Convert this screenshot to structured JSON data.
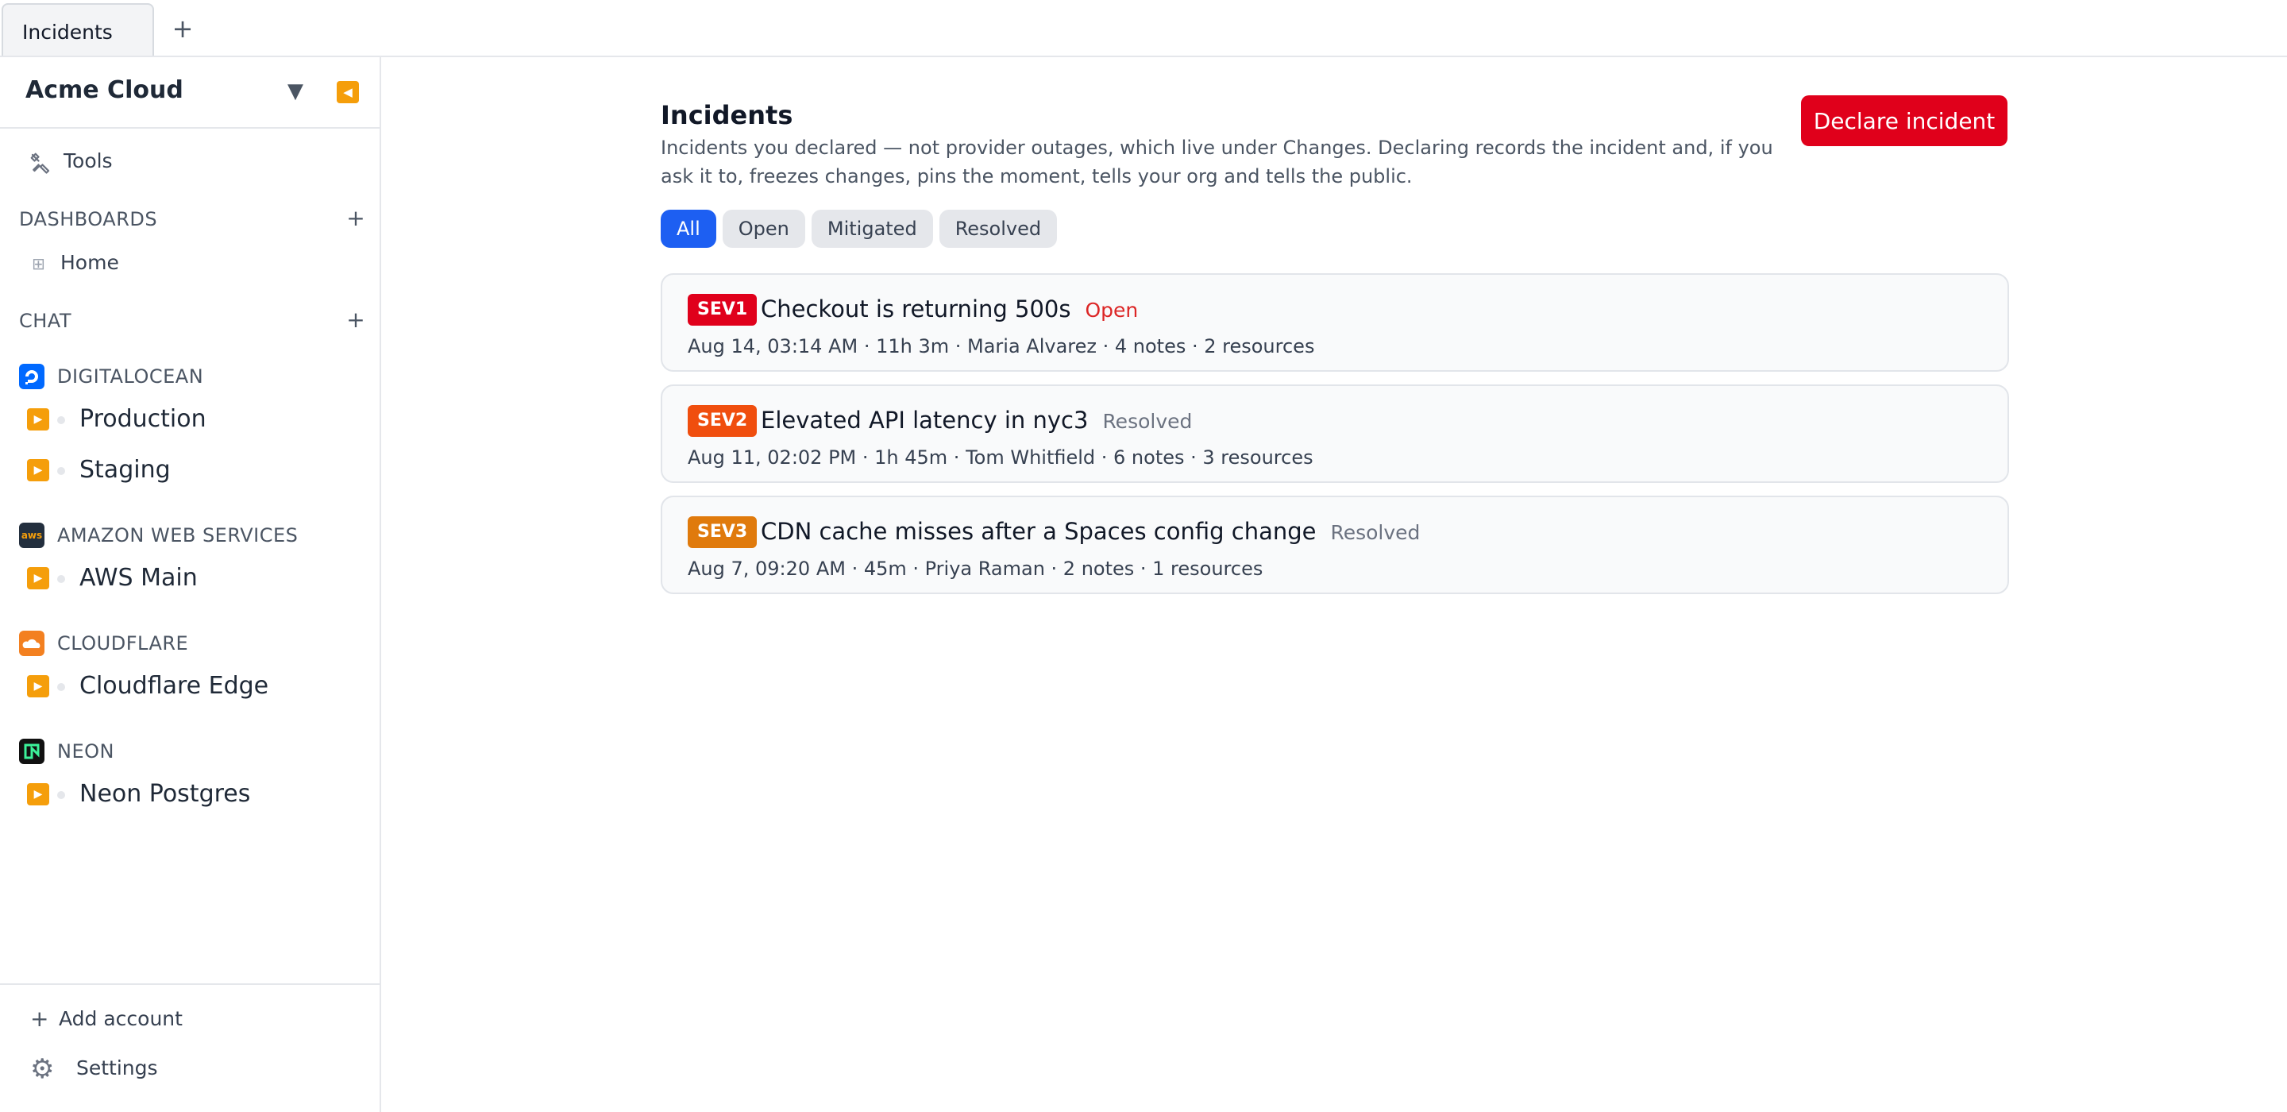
{
  "tabs": [
    {
      "label": "Incidents"
    }
  ],
  "tab_add": "+",
  "sidebar": {
    "org_name": "Acme Cloud",
    "tools_label": "Tools",
    "dashboards_label": "DASHBOARDS",
    "dashboards_add": "+",
    "home_label": "Home",
    "chat_label": "CHAT",
    "chat_add": "+",
    "providers": [
      {
        "name": "DIGITALOCEAN",
        "icon": "digitalocean-icon",
        "color": "#0069ff",
        "accounts": [
          {
            "label": "Production"
          },
          {
            "label": "Staging"
          }
        ]
      },
      {
        "name": "AMAZON WEB SERVICES",
        "icon": "aws-icon",
        "color": "#232f3e",
        "logo_text": "aws",
        "accounts": [
          {
            "label": "AWS Main"
          }
        ]
      },
      {
        "name": "CLOUDFLARE",
        "icon": "cloudflare-icon",
        "color": "#f38020",
        "accounts": [
          {
            "label": "Cloudflare Edge"
          }
        ]
      },
      {
        "name": "NEON",
        "icon": "neon-icon",
        "color": "#111111",
        "accounts": [
          {
            "label": "Neon Postgres"
          }
        ]
      }
    ],
    "add_account_label": "Add account",
    "settings_label": "Settings"
  },
  "main": {
    "title": "Incidents",
    "description": "Incidents you declared — not provider outages, which live under Changes. Declaring records the incident and, if you ask it to, freezes changes, pins the moment, tells your org and tells the public.",
    "declare_button": "Declare incident",
    "filters": [
      {
        "label": "All",
        "active": true
      },
      {
        "label": "Open",
        "active": false
      },
      {
        "label": "Mitigated",
        "active": false
      },
      {
        "label": "Resolved",
        "active": false
      }
    ],
    "incidents": [
      {
        "severity": "SEV1",
        "severity_color": "#e0001b",
        "title": "Checkout is returning 500s",
        "status": "Open",
        "status_color": "#dc2626",
        "meta": "Aug 14, 03:14 AM · 11h 3m · Maria Alvarez · 4 notes · 2 resources"
      },
      {
        "severity": "SEV2",
        "severity_color": "#f04e0e",
        "title": "Elevated API latency in nyc3",
        "status": "Resolved",
        "status_color": "#6b7280",
        "meta": "Aug 11, 02:02 PM · 1h 45m · Tom Whitfield · 6 notes · 3 resources"
      },
      {
        "severity": "SEV3",
        "severity_color": "#e07a0c",
        "title": "CDN cache misses after a Spaces config change",
        "status": "Resolved",
        "status_color": "#6b7280",
        "meta": "Aug 7, 09:20 AM · 45m · Priya Raman · 2 notes · 1 resources"
      }
    ]
  }
}
